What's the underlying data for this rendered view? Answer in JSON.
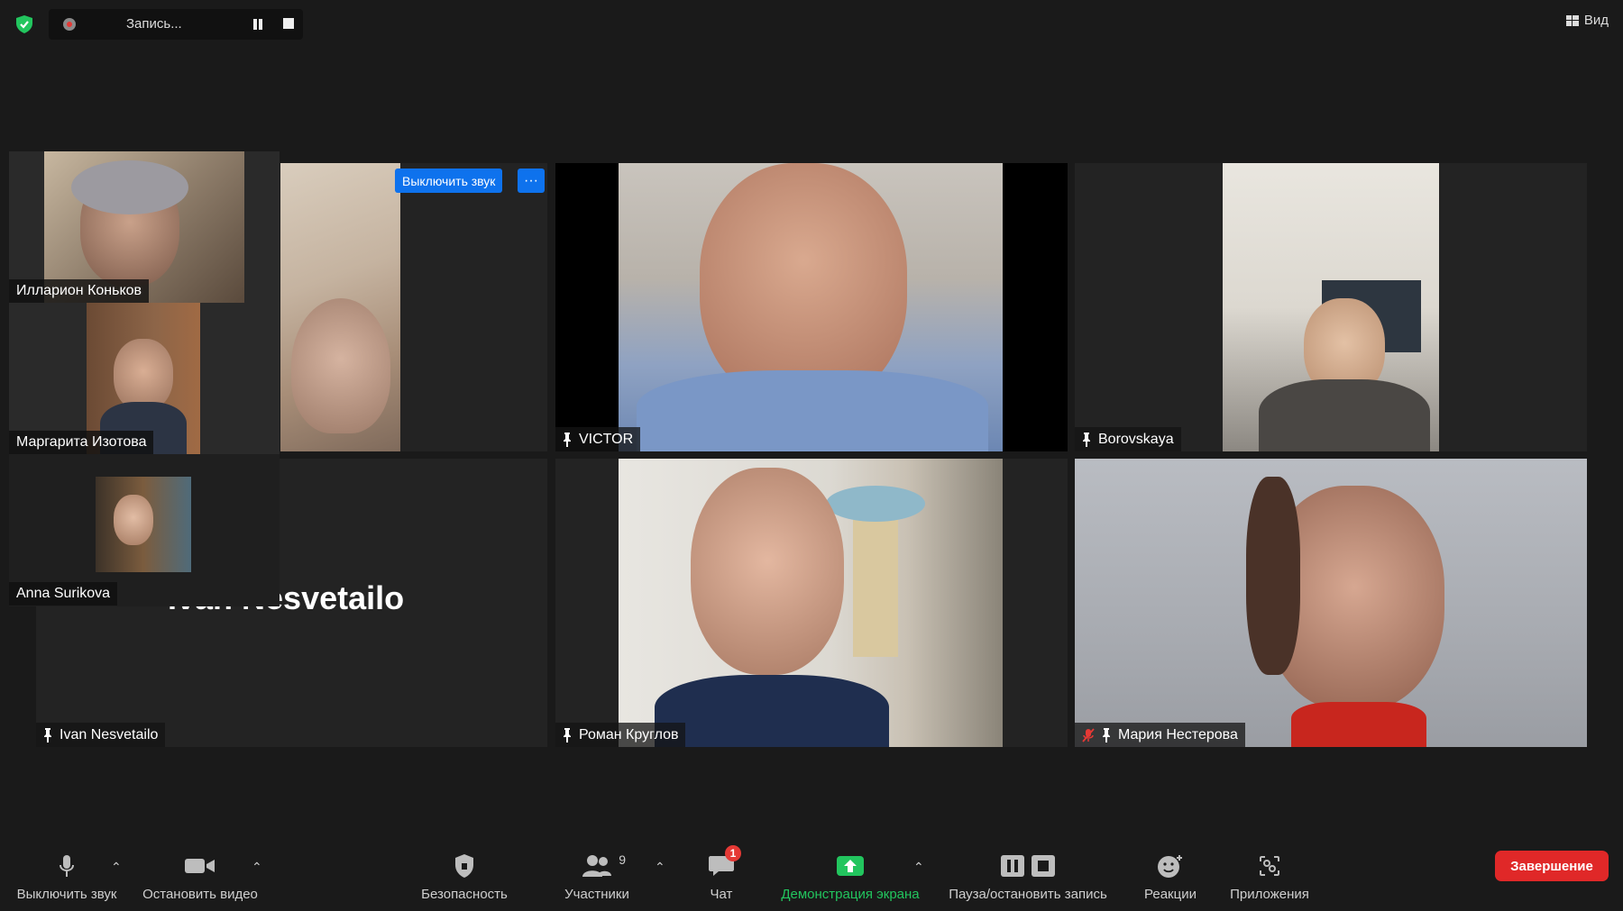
{
  "recording": {
    "status_text": "Запись..."
  },
  "view_button": {
    "label": "Вид"
  },
  "thumbnails": [
    {
      "name": "Илларион Коньков"
    },
    {
      "name": "Маргарита Изотова"
    },
    {
      "name": "Anna Surikova"
    }
  ],
  "tiles": [
    {
      "name": "",
      "mute_button": "Выключить звук",
      "more_button": "···"
    },
    {
      "name": "VICTOR"
    },
    {
      "name": "Borovskaya"
    },
    {
      "name": "Ivan Nesvetailo",
      "big_name": "Ivan Nesvetailo"
    },
    {
      "name": "Роман Круглов"
    },
    {
      "name": "Мария Нестерова",
      "muted": true
    }
  ],
  "toolbar": {
    "mute": "Выключить звук",
    "video": "Остановить видео",
    "security": "Безопасность",
    "participants": "Участники",
    "participants_count": "9",
    "chat": "Чат",
    "chat_badge": "1",
    "share": "Демонстрация экрана",
    "recording": "Пауза/остановить запись",
    "reactions": "Реакции",
    "apps": "Приложения",
    "end": "Завершение"
  },
  "colors": {
    "background": "#1a1a1a",
    "accent_blue": "#0e72ed",
    "share_green": "#22c55e",
    "end_red": "#e02828",
    "badge_red": "#e53935"
  }
}
